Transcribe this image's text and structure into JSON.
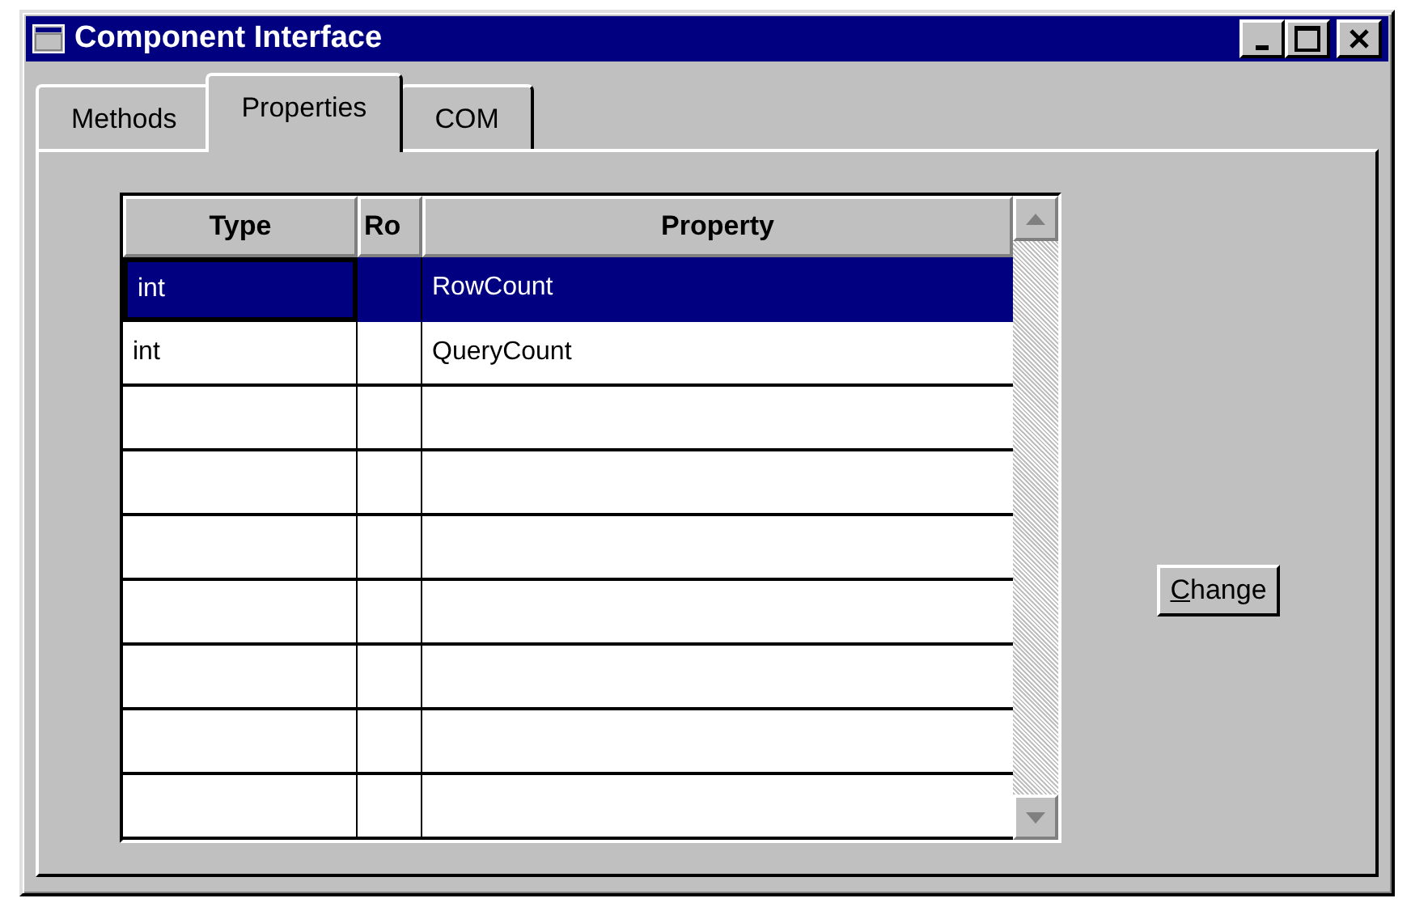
{
  "window": {
    "title": "Component Interface"
  },
  "tabs": [
    {
      "label": "Methods",
      "selected": false
    },
    {
      "label": "Properties",
      "selected": true
    },
    {
      "label": "COM",
      "selected": false
    }
  ],
  "table": {
    "columns": [
      "Type",
      "Ro",
      "Property"
    ],
    "rows": [
      {
        "type": "int",
        "property": "RowCount",
        "selected": true
      },
      {
        "type": "int",
        "property": "QueryCount",
        "selected": false
      },
      {
        "selected": false
      },
      {
        "selected": false
      },
      {
        "selected": false
      },
      {
        "selected": false
      },
      {
        "selected": false
      },
      {
        "selected": false
      },
      {
        "selected": false
      }
    ]
  },
  "buttons": [
    "Change"
  ]
}
